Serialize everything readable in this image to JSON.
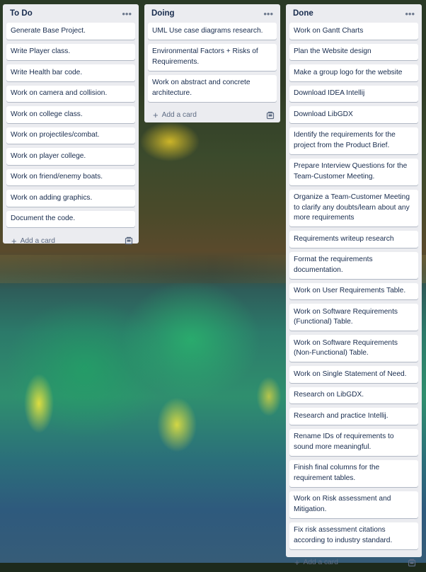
{
  "lists": [
    {
      "title": "To Do",
      "cards": [
        "Generate Base Project.",
        "Write Player class.",
        "Write Health bar code.",
        "Work on camera and collision.",
        "Work on college class.",
        "Work on projectiles/combat.",
        "Work on player college.",
        "Work on friend/enemy boats.",
        "Work on adding graphics.",
        "Document the code."
      ],
      "add_label": "Add a card"
    },
    {
      "title": "Doing",
      "cards": [
        "UML Use case diagrams research.",
        "Environmental Factors + Risks of Requirements.",
        "Work on abstract and concrete architecture."
      ],
      "add_label": "Add a card"
    },
    {
      "title": "Done",
      "cards": [
        "Work on Gantt Charts",
        "Plan the Website design",
        "Make a group logo for the website",
        "Download IDEA Intellij",
        "Download LibGDX",
        "Identify the requirements for the project from the Product Brief.",
        "Prepare Interview Questions for the Team-Customer Meeting.",
        "Organize a Team-Customer Meeting to clarify any doubts/learn about any more requirements",
        "Requirements writeup research",
        "Format the requirements documentation.",
        "Work on User Requirements Table.",
        "Work on Software Requirements (Functional) Table.",
        "Work on Software Requirements (Non-Functional) Table.",
        "Work on Single Statement of Need.",
        "Research on LibGDX.",
        "Research and practice Intellij.",
        "Rename IDs of requirements to sound more meaningful.",
        "Finish final columns for the requirement tables.",
        "Work on Risk assessment and Mitigation.",
        "Fix risk assessment citations according to industry standard."
      ],
      "add_label": "Add a card"
    }
  ],
  "icons": {
    "list_menu": "ellipsis-icon",
    "add": "plus-icon",
    "template": "card-template-icon"
  }
}
